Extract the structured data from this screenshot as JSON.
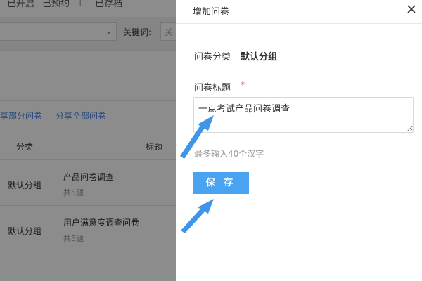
{
  "background": {
    "tabs": [
      "已开启",
      "已预约",
      "已存档"
    ],
    "separator": "|",
    "filter": {
      "chevron": "chevron-down-icon",
      "keyword_label": "关键词:",
      "keyword_placeholder": "关"
    },
    "share_links": [
      "享部分问卷",
      "分享全部问卷"
    ],
    "table": {
      "headers": [
        "分类",
        "标题"
      ],
      "rows": [
        {
          "group": "默认分组",
          "title": "产品问卷调查",
          "count": "共5题"
        },
        {
          "group": "默认分组",
          "title": "用户满意度调查问卷",
          "count": "共5题"
        }
      ]
    }
  },
  "drawer": {
    "title": "增加问卷",
    "close_icon": "close-icon",
    "category_label": "问卷分类",
    "category_value": "默认分组",
    "title_label": "问卷标题",
    "required_mark": "*",
    "title_input_value": "一点考试产品问卷调查",
    "hint": "最多输入40个汉字",
    "save_label": "保 存"
  },
  "annotations": {
    "arrow_color": "#3f95e8"
  },
  "colors": {
    "accent": "#4aa3f0",
    "link": "#3d7fe0",
    "required": "#e64545",
    "overlay": "rgba(0,0,0,0.45)"
  }
}
